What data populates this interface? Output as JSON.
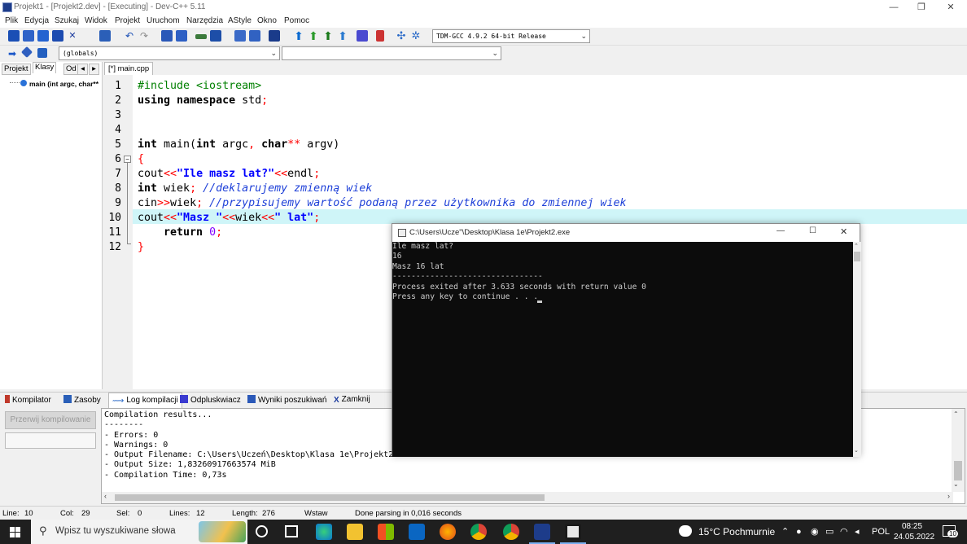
{
  "window": {
    "title": "Projekt1 - [Projekt2.dev] - [Executing] - Dev-C++ 5.11",
    "controls": {
      "minimize": "—",
      "restore": "❐",
      "close": "✕"
    }
  },
  "menu": [
    "Plik",
    "Edycja",
    "Szukaj",
    "Widok",
    "Projekt",
    "Uruchom",
    "Narzędzia",
    "AStyle",
    "Okno",
    "Pomoc"
  ],
  "toolbar": {
    "compiler_select": "TDM-GCC 4.9.2 64-bit Release",
    "scope_select": "(globals)",
    "function_select": ""
  },
  "left_panel": {
    "tabs": [
      "Projekt",
      "Klasy",
      "Od"
    ],
    "active_tab": "Klasy",
    "tree_item": "main (int argc, char**"
  },
  "editor": {
    "tab_label": "[*] main.cpp",
    "highlight_line": 10,
    "line_numbers": [
      "1",
      "2",
      "3",
      "4",
      "5",
      "6",
      "7",
      "8",
      "9",
      "10",
      "11",
      "12"
    ]
  },
  "bottom_panel": {
    "tabs": [
      "Kompilator",
      "Zasoby",
      "Log kompilacji",
      "Odpluskwiacz",
      "Wyniki poszukiwań",
      "Zamknij"
    ],
    "active_tab": "Log kompilacji",
    "abort_button": "Przerwij kompilowanie",
    "log_lines": [
      "Compilation results...",
      "--------",
      "- Errors: 0",
      "- Warnings: 0",
      "- Output Filename: C:\\Users\\Uczeń\\Desktop\\Klasa 1e\\Projekt2.exe",
      "- Output Size: 1,83260917663574 MiB",
      "- Compilation Time: 0,73s"
    ]
  },
  "status": {
    "line": "Line:",
    "line_val": "10",
    "col": "Col:",
    "col_val": "29",
    "sel": "Sel:",
    "sel_val": "0",
    "lines": "Lines:",
    "lines_val": "12",
    "length": "Length:",
    "length_val": "276",
    "mode": "Wstaw",
    "message": "Done parsing in 0,016 seconds"
  },
  "console": {
    "title": "C:\\Users\\Ucze\"\\Desktop\\Klasa 1e\\Projekt2.exe",
    "lines": [
      "Ile masz lat?",
      "16",
      "Masz 16 lat",
      "--------------------------------",
      "Process exited after 3.633 seconds with return value 0",
      "Press any key to continue . . . "
    ]
  },
  "taskbar": {
    "search_placeholder": "Wpisz tu wyszukiwane słowa",
    "weather": "15°C Pochmurnie",
    "language": "POL",
    "time": "08:25",
    "date": "24.05.2022",
    "notifications": "10"
  },
  "colors": {
    "keyword": "#000000",
    "string": "#0000ff",
    "comment": "#1e40d8",
    "symbol": "#ff0000",
    "preprocessor": "#008000",
    "number": "#8000ff",
    "highlight": "#cff5f8"
  }
}
